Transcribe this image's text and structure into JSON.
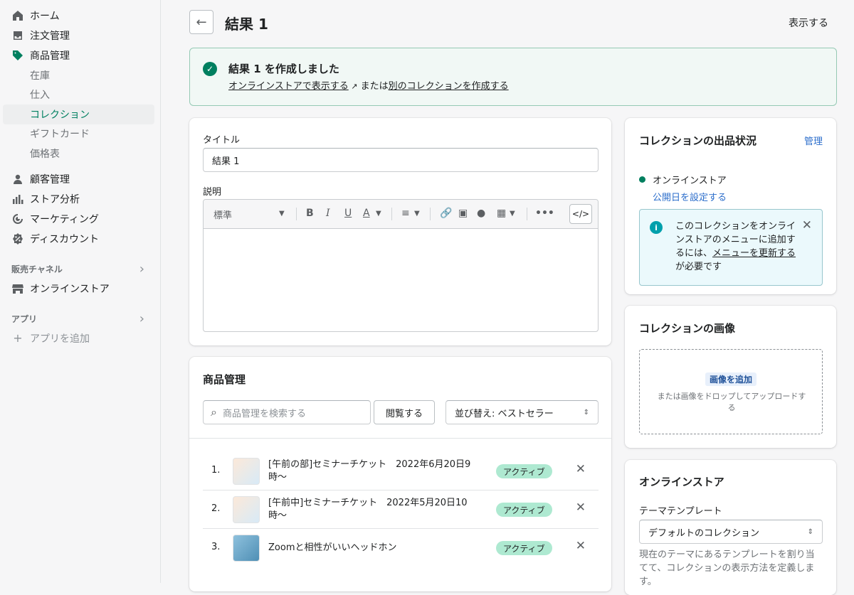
{
  "sidebar": {
    "home": "ホーム",
    "orders": "注文管理",
    "products": "商品管理",
    "sub": [
      "在庫",
      "仕入",
      "コレクション",
      "ギフトカード",
      "価格表"
    ],
    "customers": "顧客管理",
    "analytics": "ストア分析",
    "marketing": "マーケティング",
    "discounts": "ディスカウント",
    "sales_channels": "販売チャネル",
    "online_store": "オンラインストア",
    "apps": "アプリ",
    "add_app": "アプリを追加"
  },
  "header": {
    "title": "結果 1",
    "view": "表示する"
  },
  "banner": {
    "title": "結果 1 を作成しました",
    "link1": "オンラインストアで表示する",
    "middle": "または",
    "link2": "別のコレクションを作成する"
  },
  "form": {
    "title_label": "タイトル",
    "title_value": "結果 1",
    "desc_label": "説明",
    "format": "標準"
  },
  "products": {
    "title": "商品管理",
    "search_placeholder": "商品管理を検索する",
    "browse": "閲覧する",
    "sort": "並び替え: ベストセラー",
    "items": [
      {
        "num": "1.",
        "name": "[午前の部]セミナーチケット　2022年6月20日9時〜",
        "status": "アクティブ"
      },
      {
        "num": "2.",
        "name": "[午前中]セミナーチケット　2022年5月20日10時〜",
        "status": "アクティブ"
      },
      {
        "num": "3.",
        "name": "Zoomと相性がいいヘッドホン",
        "status": "アクティブ"
      }
    ]
  },
  "availability": {
    "title": "コレクションの出品状況",
    "manage": "管理",
    "channel": "オンラインストア",
    "set_date": "公開日を設定する",
    "info_prefix": "このコレクションをオンラインストアのメニューに追加するには、",
    "info_link": "メニューを更新する",
    "info_suffix": "が必要です"
  },
  "image": {
    "title": "コレクションの画像",
    "add": "画像を追加",
    "hint": "または画像をドロップしてアップロードする"
  },
  "online": {
    "title": "オンラインストア",
    "template_label": "テーマテンプレート",
    "template_value": "デフォルトのコレクション",
    "help": "現在のテーマにあるテンプレートを割り当てて、コレクションの表示方法を定義します。"
  },
  "colors": {
    "accent": "#008060",
    "link": "#2c6ecb",
    "badge": "#aee9d1"
  }
}
